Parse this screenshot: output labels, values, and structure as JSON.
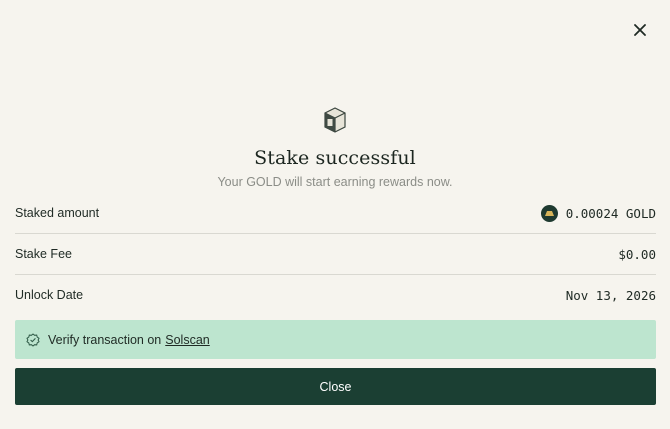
{
  "dialog": {
    "close_icon": "close-icon",
    "hero_icon": "gold-cube-icon",
    "title": "Stake successful",
    "subtitle": "Your GOLD will start earning rewards now."
  },
  "details": [
    {
      "label": "Staked amount",
      "value": "0.00024 GOLD",
      "icon": "gold-coin-icon"
    },
    {
      "label": "Stake Fee",
      "value": "$0.00"
    },
    {
      "label": "Unlock Date",
      "value": "Nov 13, 2026"
    }
  ],
  "verify": {
    "icon": "verified-badge-icon",
    "text": "Verify transaction on",
    "link": "Solscan"
  },
  "actions": {
    "close_label": "Close"
  },
  "colors": {
    "background": "#f6f4ee",
    "primary_button": "#1b3f33",
    "verify_banner": "#bde5cf"
  }
}
